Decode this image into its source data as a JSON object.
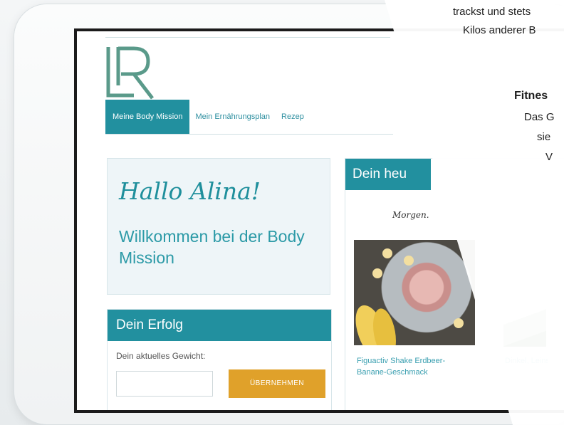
{
  "brand": {
    "logo_text": "LR",
    "logo_color": "#5a9a8a"
  },
  "nav": {
    "items": [
      {
        "label": "Meine Body Mission",
        "active": true
      },
      {
        "label": "Mein Ernährungsplan",
        "active": false
      },
      {
        "label": "Rezep",
        "active": false
      }
    ]
  },
  "greeting": {
    "hello": "Hallo Alina!",
    "welcome": "Willkommen bei der Body Mission"
  },
  "success": {
    "title": "Dein Erfolg",
    "weight_label": "Dein aktuelles Gewicht:",
    "weight_value": "",
    "apply_label": "ÜBERNEHMEN"
  },
  "plan": {
    "tab_label": "Dein heu",
    "morning_label": "Morgen.",
    "item1_caption": "Figuactiv Shake Erdbeer-Banane-Geschmack",
    "item2_caption": "Dinkel, Leinsamen Joghurt"
  },
  "promo": {
    "line1": "trackst und stets",
    "line2": "Kilos anderer B",
    "heading": "Fitnes",
    "line3": "Das G",
    "line4": "sie",
    "line5": "V"
  },
  "colors": {
    "accent": "#22909f",
    "button": "#e0a12a"
  }
}
